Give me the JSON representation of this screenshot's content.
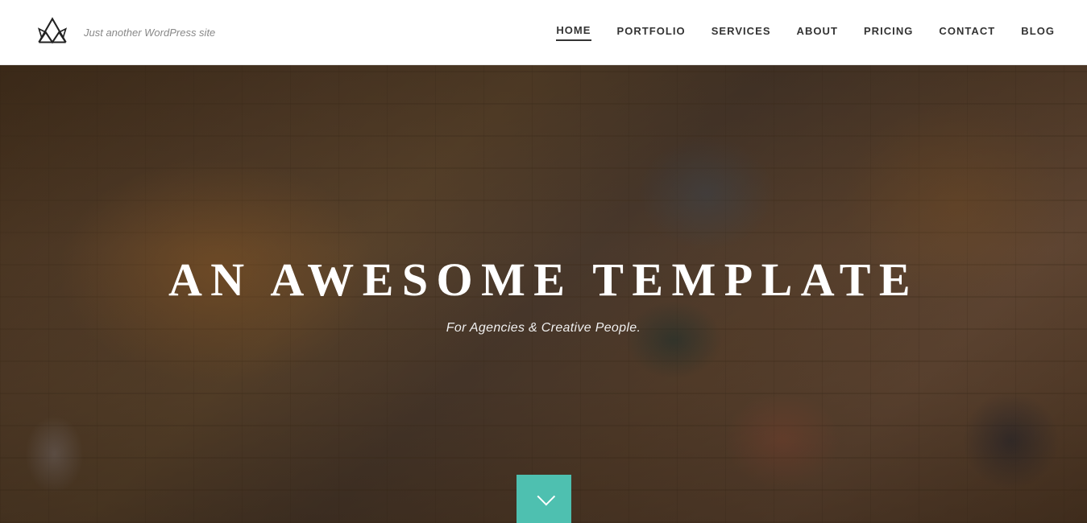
{
  "header": {
    "logo_tagline": "Just another WordPress site",
    "nav_items": [
      {
        "label": "HOME",
        "active": true
      },
      {
        "label": "PORTFOLIO",
        "active": false
      },
      {
        "label": "SERVICES",
        "active": false
      },
      {
        "label": "ABOUT",
        "active": false
      },
      {
        "label": "PRICING",
        "active": false
      },
      {
        "label": "CONTACT",
        "active": false
      },
      {
        "label": "BLOG",
        "active": false
      }
    ]
  },
  "hero": {
    "title": "AN AWESOME TEMPLATE",
    "subtitle": "For Agencies & Creative People.",
    "scroll_button_label": "↓"
  },
  "colors": {
    "accent_teal": "#4ec0b0",
    "nav_active_border": "#333333",
    "header_bg": "#ffffff"
  }
}
